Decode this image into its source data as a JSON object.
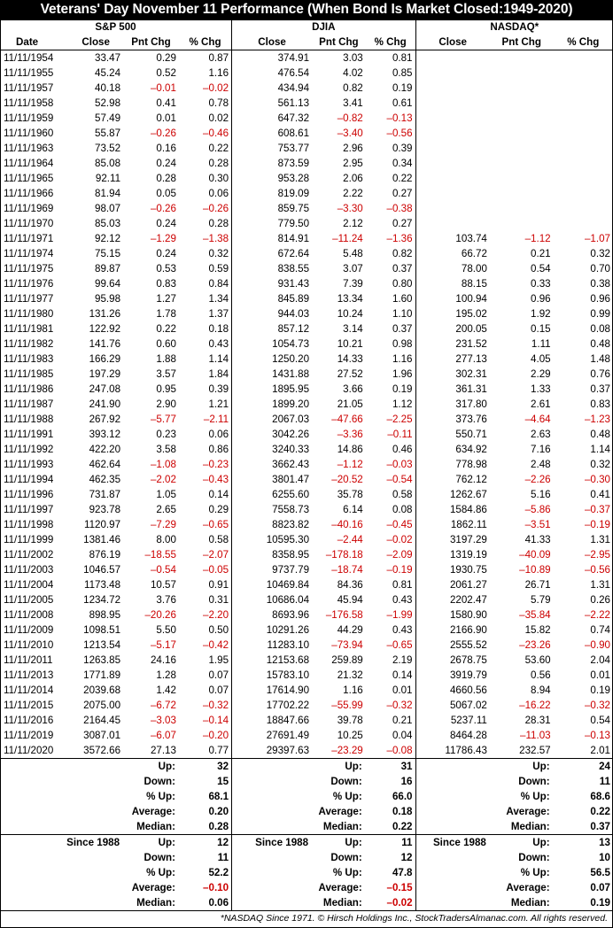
{
  "title": "Veterans' Day November 11 Performance (When Bond Is Market Closed:1949-2020)",
  "groups": [
    "S&P 500",
    "DJIA",
    "NASDAQ*"
  ],
  "columns": [
    "Date",
    "Close",
    "Pnt Chg",
    "% Chg",
    "Close",
    "Pnt Chg",
    "% Chg",
    "Close",
    "Pnt Chg",
    "% Chg"
  ],
  "rows": [
    [
      "11/11/1954",
      "33.47",
      "0.29",
      "0.87",
      "374.91",
      "3.03",
      "0.81",
      "",
      "",
      ""
    ],
    [
      "11/11/1955",
      "45.24",
      "0.52",
      "1.16",
      "476.54",
      "4.02",
      "0.85",
      "",
      "",
      ""
    ],
    [
      "11/11/1957",
      "40.18",
      "–0.01",
      "–0.02",
      "434.94",
      "0.82",
      "0.19",
      "",
      "",
      ""
    ],
    [
      "11/11/1958",
      "52.98",
      "0.41",
      "0.78",
      "561.13",
      "3.41",
      "0.61",
      "",
      "",
      ""
    ],
    [
      "11/11/1959",
      "57.49",
      "0.01",
      "0.02",
      "647.32",
      "–0.82",
      "–0.13",
      "",
      "",
      ""
    ],
    [
      "11/11/1960",
      "55.87",
      "–0.26",
      "–0.46",
      "608.61",
      "–3.40",
      "–0.56",
      "",
      "",
      ""
    ],
    [
      "11/11/1963",
      "73.52",
      "0.16",
      "0.22",
      "753.77",
      "2.96",
      "0.39",
      "",
      "",
      ""
    ],
    [
      "11/11/1964",
      "85.08",
      "0.24",
      "0.28",
      "873.59",
      "2.95",
      "0.34",
      "",
      "",
      ""
    ],
    [
      "11/11/1965",
      "92.11",
      "0.28",
      "0.30",
      "953.28",
      "2.06",
      "0.22",
      "",
      "",
      ""
    ],
    [
      "11/11/1966",
      "81.94",
      "0.05",
      "0.06",
      "819.09",
      "2.22",
      "0.27",
      "",
      "",
      ""
    ],
    [
      "11/11/1969",
      "98.07",
      "–0.26",
      "–0.26",
      "859.75",
      "–3.30",
      "–0.38",
      "",
      "",
      ""
    ],
    [
      "11/11/1970",
      "85.03",
      "0.24",
      "0.28",
      "779.50",
      "2.12",
      "0.27",
      "",
      "",
      ""
    ],
    [
      "11/11/1971",
      "92.12",
      "–1.29",
      "–1.38",
      "814.91",
      "–11.24",
      "–1.36",
      "103.74",
      "–1.12",
      "–1.07"
    ],
    [
      "11/11/1974",
      "75.15",
      "0.24",
      "0.32",
      "672.64",
      "5.48",
      "0.82",
      "66.72",
      "0.21",
      "0.32"
    ],
    [
      "11/11/1975",
      "89.87",
      "0.53",
      "0.59",
      "838.55",
      "3.07",
      "0.37",
      "78.00",
      "0.54",
      "0.70"
    ],
    [
      "11/11/1976",
      "99.64",
      "0.83",
      "0.84",
      "931.43",
      "7.39",
      "0.80",
      "88.15",
      "0.33",
      "0.38"
    ],
    [
      "11/11/1977",
      "95.98",
      "1.27",
      "1.34",
      "845.89",
      "13.34",
      "1.60",
      "100.94",
      "0.96",
      "0.96"
    ],
    [
      "11/11/1980",
      "131.26",
      "1.78",
      "1.37",
      "944.03",
      "10.24",
      "1.10",
      "195.02",
      "1.92",
      "0.99"
    ],
    [
      "11/11/1981",
      "122.92",
      "0.22",
      "0.18",
      "857.12",
      "3.14",
      "0.37",
      "200.05",
      "0.15",
      "0.08"
    ],
    [
      "11/11/1982",
      "141.76",
      "0.60",
      "0.43",
      "1054.73",
      "10.21",
      "0.98",
      "231.52",
      "1.11",
      "0.48"
    ],
    [
      "11/11/1983",
      "166.29",
      "1.88",
      "1.14",
      "1250.20",
      "14.33",
      "1.16",
      "277.13",
      "4.05",
      "1.48"
    ],
    [
      "11/11/1985",
      "197.29",
      "3.57",
      "1.84",
      "1431.88",
      "27.52",
      "1.96",
      "302.31",
      "2.29",
      "0.76"
    ],
    [
      "11/11/1986",
      "247.08",
      "0.95",
      "0.39",
      "1895.95",
      "3.66",
      "0.19",
      "361.31",
      "1.33",
      "0.37"
    ],
    [
      "11/11/1987",
      "241.90",
      "2.90",
      "1.21",
      "1899.20",
      "21.05",
      "1.12",
      "317.80",
      "2.61",
      "0.83"
    ],
    [
      "11/11/1988",
      "267.92",
      "–5.77",
      "–2.11",
      "2067.03",
      "–47.66",
      "–2.25",
      "373.76",
      "–4.64",
      "–1.23"
    ],
    [
      "11/11/1991",
      "393.12",
      "0.23",
      "0.06",
      "3042.26",
      "–3.36",
      "–0.11",
      "550.71",
      "2.63",
      "0.48"
    ],
    [
      "11/11/1992",
      "422.20",
      "3.58",
      "0.86",
      "3240.33",
      "14.86",
      "0.46",
      "634.92",
      "7.16",
      "1.14"
    ],
    [
      "11/11/1993",
      "462.64",
      "–1.08",
      "–0.23",
      "3662.43",
      "–1.12",
      "–0.03",
      "778.98",
      "2.48",
      "0.32"
    ],
    [
      "11/11/1994",
      "462.35",
      "–2.02",
      "–0.43",
      "3801.47",
      "–20.52",
      "–0.54",
      "762.12",
      "–2.26",
      "–0.30"
    ],
    [
      "11/11/1996",
      "731.87",
      "1.05",
      "0.14",
      "6255.60",
      "35.78",
      "0.58",
      "1262.67",
      "5.16",
      "0.41"
    ],
    [
      "11/11/1997",
      "923.78",
      "2.65",
      "0.29",
      "7558.73",
      "6.14",
      "0.08",
      "1584.86",
      "–5.86",
      "–0.37"
    ],
    [
      "11/11/1998",
      "1120.97",
      "–7.29",
      "–0.65",
      "8823.82",
      "–40.16",
      "–0.45",
      "1862.11",
      "–3.51",
      "–0.19"
    ],
    [
      "11/11/1999",
      "1381.46",
      "8.00",
      "0.58",
      "10595.30",
      "–2.44",
      "–0.02",
      "3197.29",
      "41.33",
      "1.31"
    ],
    [
      "11/11/2002",
      "876.19",
      "–18.55",
      "–2.07",
      "8358.95",
      "–178.18",
      "–2.09",
      "1319.19",
      "–40.09",
      "–2.95"
    ],
    [
      "11/11/2003",
      "1046.57",
      "–0.54",
      "–0.05",
      "9737.79",
      "–18.74",
      "–0.19",
      "1930.75",
      "–10.89",
      "–0.56"
    ],
    [
      "11/11/2004",
      "1173.48",
      "10.57",
      "0.91",
      "10469.84",
      "84.36",
      "0.81",
      "2061.27",
      "26.71",
      "1.31"
    ],
    [
      "11/11/2005",
      "1234.72",
      "3.76",
      "0.31",
      "10686.04",
      "45.94",
      "0.43",
      "2202.47",
      "5.79",
      "0.26"
    ],
    [
      "11/11/2008",
      "898.95",
      "–20.26",
      "–2.20",
      "8693.96",
      "–176.58",
      "–1.99",
      "1580.90",
      "–35.84",
      "–2.22"
    ],
    [
      "11/11/2009",
      "1098.51",
      "5.50",
      "0.50",
      "10291.26",
      "44.29",
      "0.43",
      "2166.90",
      "15.82",
      "0.74"
    ],
    [
      "11/11/2010",
      "1213.54",
      "–5.17",
      "–0.42",
      "11283.10",
      "–73.94",
      "–0.65",
      "2555.52",
      "–23.26",
      "–0.90"
    ],
    [
      "11/11/2011",
      "1263.85",
      "24.16",
      "1.95",
      "12153.68",
      "259.89",
      "2.19",
      "2678.75",
      "53.60",
      "2.04"
    ],
    [
      "11/11/2013",
      "1771.89",
      "1.28",
      "0.07",
      "15783.10",
      "21.32",
      "0.14",
      "3919.79",
      "0.56",
      "0.01"
    ],
    [
      "11/11/2014",
      "2039.68",
      "1.42",
      "0.07",
      "17614.90",
      "1.16",
      "0.01",
      "4660.56",
      "8.94",
      "0.19"
    ],
    [
      "11/11/2015",
      "2075.00",
      "–6.72",
      "–0.32",
      "17702.22",
      "–55.99",
      "–0.32",
      "5067.02",
      "–16.22",
      "–0.32"
    ],
    [
      "11/11/2016",
      "2164.45",
      "–3.03",
      "–0.14",
      "18847.66",
      "39.78",
      "0.21",
      "5237.11",
      "28.31",
      "0.54"
    ],
    [
      "11/11/2019",
      "3087.01",
      "–6.07",
      "–0.20",
      "27691.49",
      "10.25",
      "0.04",
      "8464.28",
      "–11.03",
      "–0.13"
    ],
    [
      "11/11/2020",
      "3572.66",
      "27.13",
      "0.77",
      "29397.63",
      "–23.29",
      "–0.08",
      "11786.43",
      "232.57",
      "2.01"
    ]
  ],
  "summary_all": {
    "labels": [
      "Up:",
      "Down:",
      "% Up:",
      "Average:",
      "Median:"
    ],
    "sp500": [
      "32",
      "15",
      "68.1",
      "0.20",
      "0.28"
    ],
    "djia": [
      "31",
      "16",
      "66.0",
      "0.18",
      "0.22"
    ],
    "nasdaq": [
      "24",
      "11",
      "68.6",
      "0.22",
      "0.37"
    ]
  },
  "summary_since": {
    "since_label": "Since 1988",
    "labels": [
      "Up:",
      "Down:",
      "% Up:",
      "Average:",
      "Median:"
    ],
    "sp500": [
      "12",
      "11",
      "52.2",
      "–0.10",
      "0.06"
    ],
    "djia": [
      "11",
      "12",
      "47.8",
      "–0.15",
      "–0.02"
    ],
    "nasdaq": [
      "13",
      "10",
      "56.5",
      "0.07",
      "0.19"
    ]
  },
  "footer": "*NASDAQ Since 1971. © Hirsch Holdings Inc., StockTradersAlmanac.com. All rights reserved.",
  "colors": {
    "negative": "#cc0000",
    "header_bg": "#000000",
    "header_text": "#ffffff"
  }
}
